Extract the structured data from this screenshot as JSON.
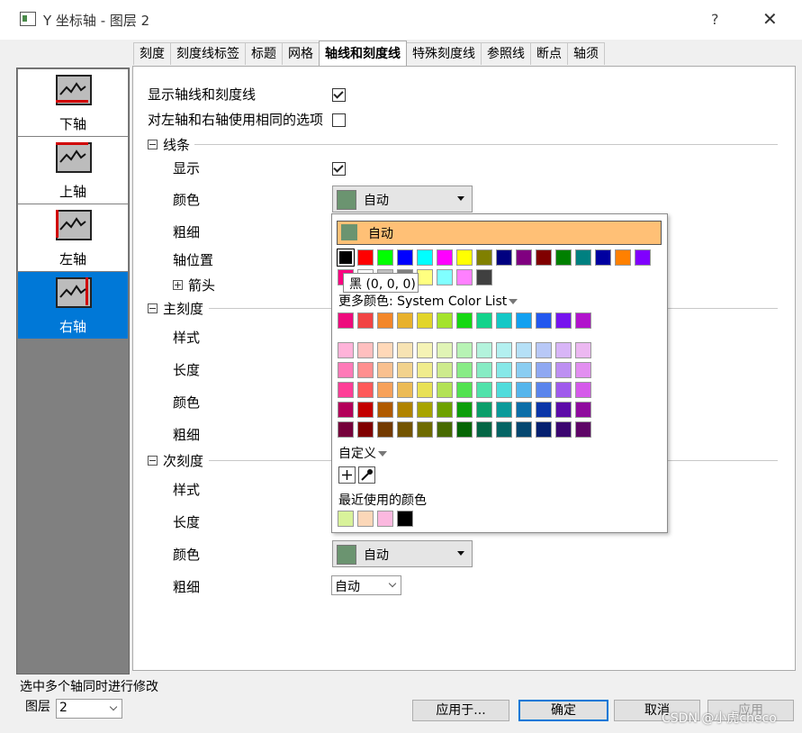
{
  "window": {
    "title": "Y 坐标轴 - 图层 2",
    "help": "?",
    "close": "✕"
  },
  "tabs": [
    "刻度",
    "刻度线标签",
    "标题",
    "网格",
    "轴线和刻度线",
    "特殊刻度线",
    "参照线",
    "断点",
    "轴须"
  ],
  "active_tab": 4,
  "axes": [
    {
      "label": "下轴",
      "selected": false
    },
    {
      "label": "上轴",
      "selected": false
    },
    {
      "label": "左轴",
      "selected": false
    },
    {
      "label": "右轴",
      "selected": true
    }
  ],
  "options": {
    "show_axis_ticks": {
      "label": "显示轴线和刻度线",
      "checked": true
    },
    "same_options": {
      "label": "对左轴和右轴使用相同的选项",
      "checked": false
    }
  },
  "line_group": {
    "title": "线条",
    "show_label": "显示",
    "show_checked": true,
    "color_label": "颜色",
    "color_value": "自动",
    "thickness_label": "粗细",
    "axis_pos_label": "轴位置",
    "arrow_label": "箭头"
  },
  "major_group": {
    "title": "主刻度",
    "style_label": "样式",
    "length_label": "长度",
    "color_label": "颜色",
    "thickness_label": "粗细"
  },
  "minor_group": {
    "title": "次刻度",
    "style_label": "样式",
    "length_label": "长度",
    "color_label": "颜色",
    "color_value": "自动",
    "thickness_label": "粗细",
    "thickness_value": "自动"
  },
  "color_popup": {
    "auto_label": "自动",
    "auto_color": "#6b9470",
    "tooltip": "黑 (0, 0, 0)",
    "more_label": "更多颜色: System Color List",
    "custom_label": "自定义",
    "recent_label": "最近使用的颜色",
    "basic_row1": [
      "#000000",
      "#ff0000",
      "#00ff00",
      "#0000ff",
      "#00ffff",
      "#ff00ff",
      "#ffff00",
      "#808000",
      "#000080",
      "#800080",
      "#800000",
      "#008000",
      "#008080",
      "#0000a0",
      "#ff8000",
      "#8000ff"
    ],
    "basic_row2": [
      "#ff0080",
      "#ffffff",
      "#c0c0c0",
      "#808080",
      "#ffff80",
      "#80ffff",
      "#ff80ff",
      "#404040"
    ],
    "palette_top": [
      "#ee0b7d",
      "#f24444",
      "#f3872a",
      "#e8b12c",
      "#e2d52a",
      "#a4e32c",
      "#16d813",
      "#13d38b",
      "#14c8c6",
      "#12a0f0",
      "#2357ee",
      "#7614ee",
      "#b113cc"
    ],
    "palette_rows": [
      [
        "#ffb3d9",
        "#ffbfbf",
        "#ffd8b8",
        "#f7e3b3",
        "#f5f3b5",
        "#e0f4b5",
        "#b7f3b4",
        "#b3f3dc",
        "#b3f0f0",
        "#b5e0f7",
        "#b8c8f7",
        "#d8b5f7",
        "#ecb8f1"
      ],
      [
        "#ff7ab8",
        "#ff8f8f",
        "#f9c08f",
        "#f2d28c",
        "#f0ec8c",
        "#cdeb8c",
        "#88ec86",
        "#86ecc4",
        "#86e8e8",
        "#8acdf2",
        "#8fa8f2",
        "#bd8ff2",
        "#e28ff0"
      ],
      [
        "#ff3e97",
        "#ff5a5a",
        "#f7a15a",
        "#ecbb55",
        "#e8e155",
        "#b3e255",
        "#52e250",
        "#50e2aa",
        "#50dcdc",
        "#55b5ec",
        "#5a84ec",
        "#9f5aec",
        "#d55aea"
      ],
      [
        "#b3005a",
        "#c30000",
        "#b05a00",
        "#b08300",
        "#a8a400",
        "#6ea100",
        "#0d9e0b",
        "#0b9e6a",
        "#0b9a9a",
        "#0b6ea8",
        "#0b35a8",
        "#5c0ba8",
        "#8f0b9e"
      ],
      [
        "#75003b",
        "#800000",
        "#733a00",
        "#735400",
        "#6e6b00",
        "#476a00",
        "#066605",
        "#056645",
        "#056464",
        "#054770",
        "#052070",
        "#3b0570",
        "#5e0567"
      ]
    ],
    "recent": [
      "#d8f29a",
      "#fbd7b8",
      "#fbb8df",
      "#000000"
    ]
  },
  "status": "选中多个轴同时进行修改",
  "layer": {
    "label": "图层",
    "value": "2"
  },
  "buttons": {
    "apply_to": "应用于...",
    "ok": "确定",
    "cancel": "取消",
    "apply": "应用"
  },
  "watermark": "CSDN @小虎checo"
}
